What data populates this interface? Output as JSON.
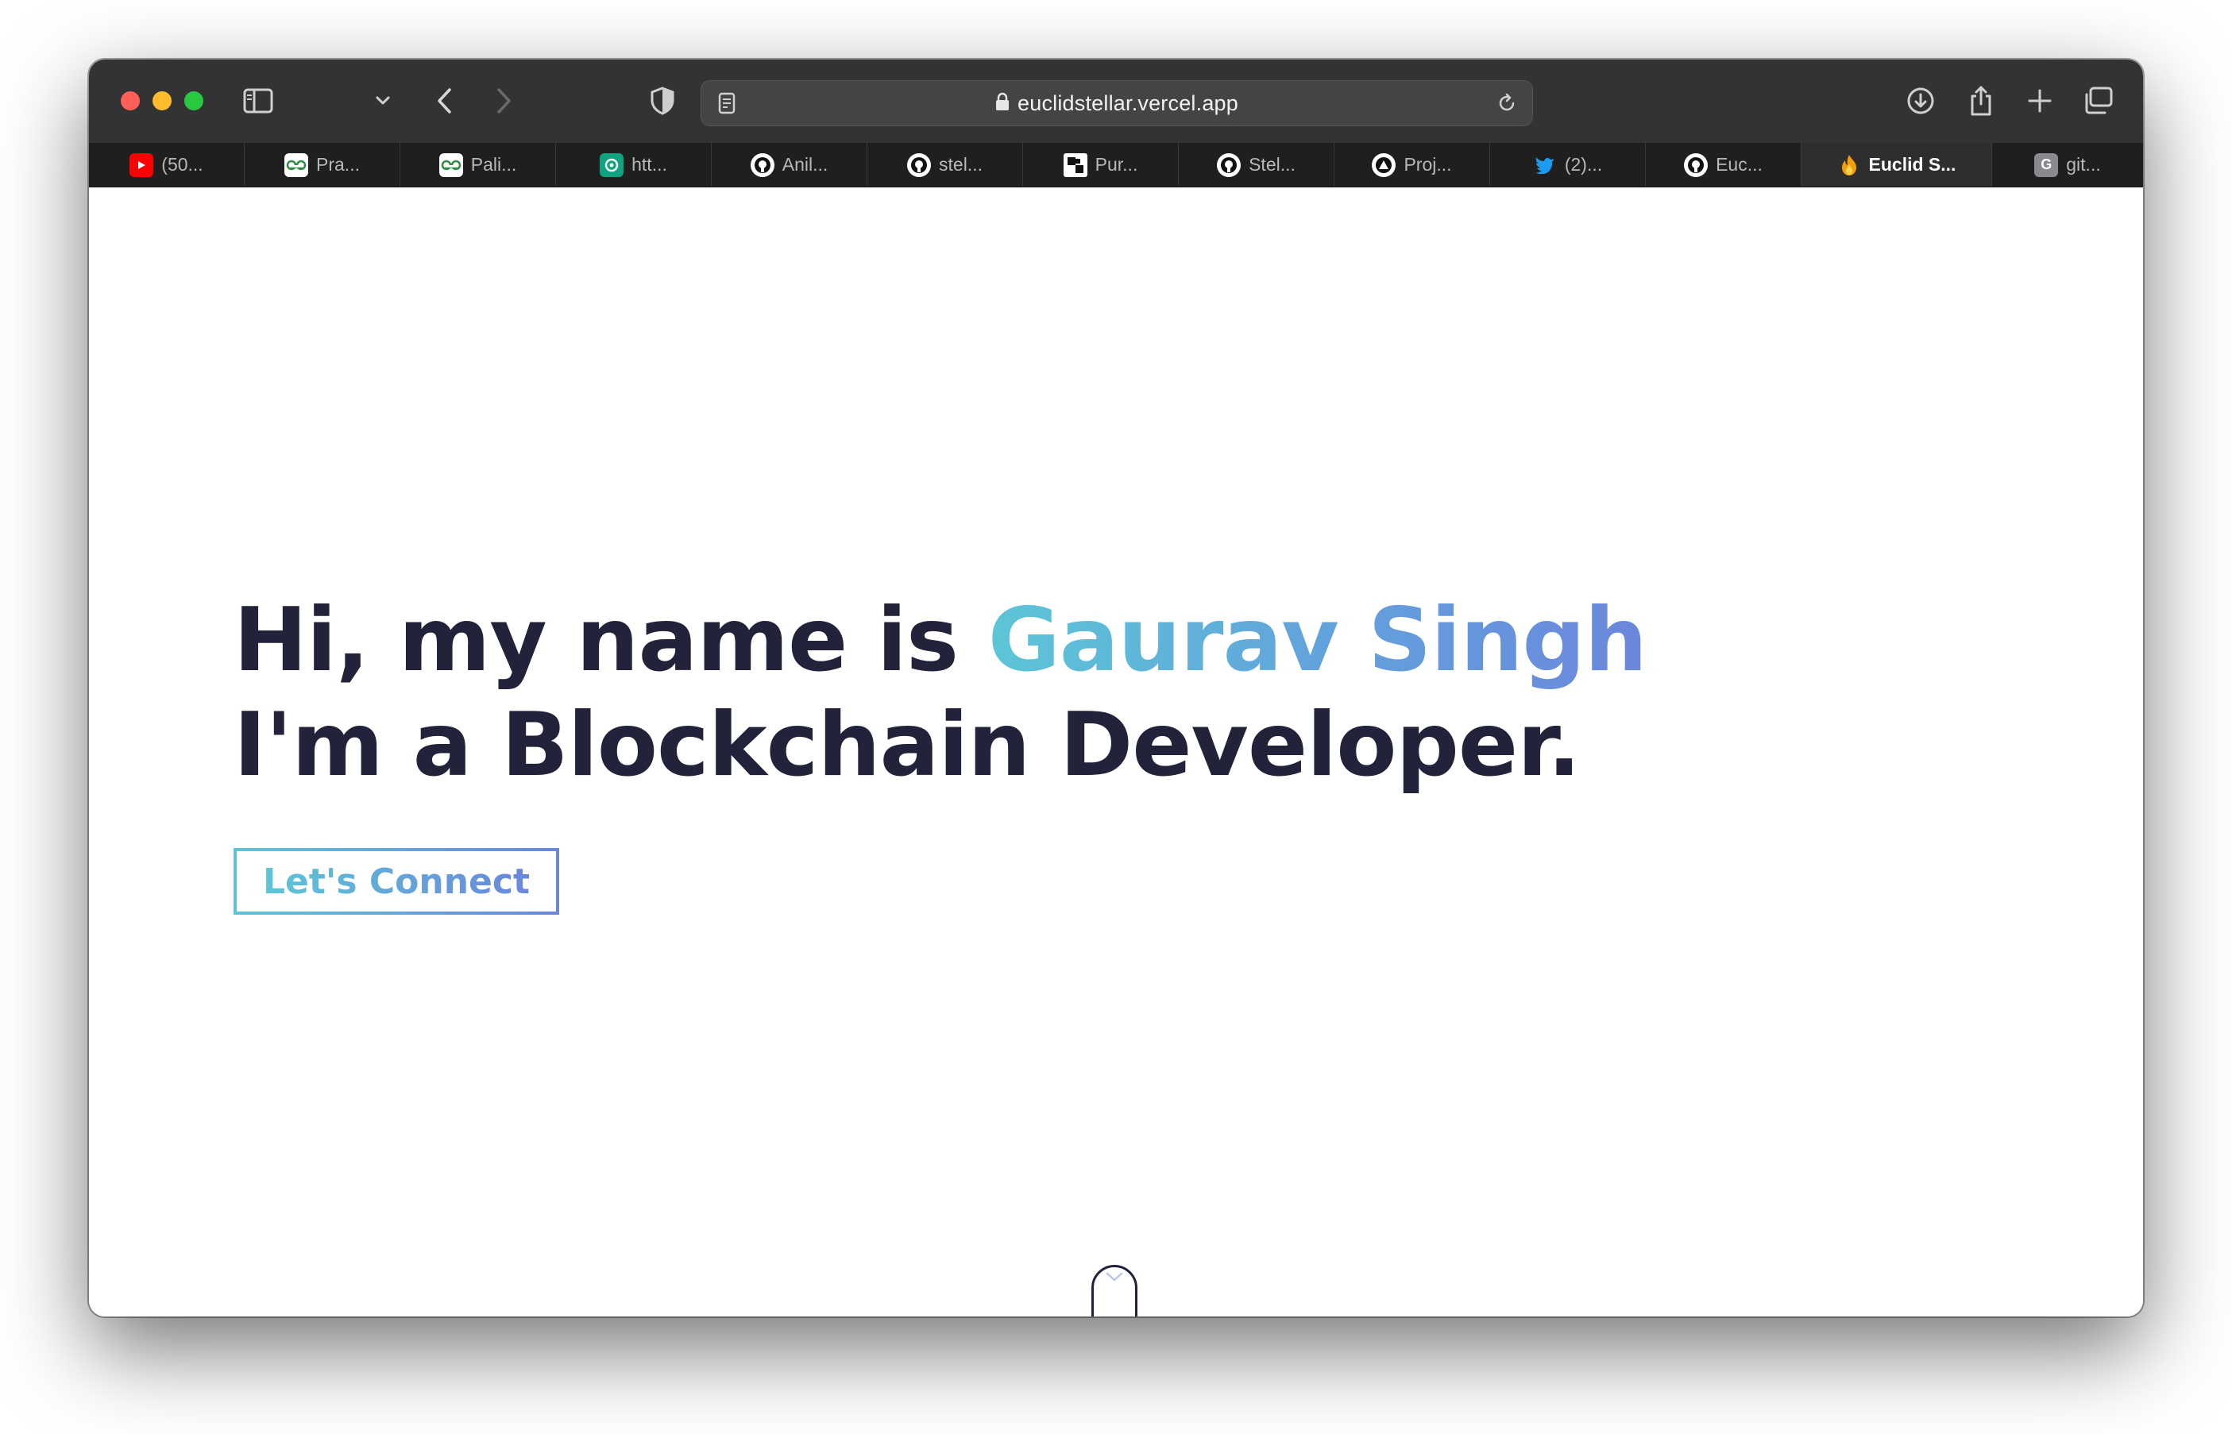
{
  "browser": {
    "url": "euclidstellar.vercel.app",
    "tabs": [
      {
        "label": "(50...",
        "icon": "youtube-icon",
        "color": "#ff0000"
      },
      {
        "label": "Pra...",
        "icon": "geeksforgeeks-icon",
        "color": "#2f8d46"
      },
      {
        "label": "Pali...",
        "icon": "geeksforgeeks-icon",
        "color": "#2f8d46"
      },
      {
        "label": "htt...",
        "icon": "chatgpt-icon",
        "color": "#10a37f"
      },
      {
        "label": "Anil...",
        "icon": "github-icon",
        "color": "#ffffff"
      },
      {
        "label": "stel...",
        "icon": "github-icon",
        "color": "#ffffff"
      },
      {
        "label": "Pur...",
        "icon": "grid-icon",
        "color": "#ffffff"
      },
      {
        "label": "Stel...",
        "icon": "github-icon",
        "color": "#ffffff"
      },
      {
        "label": "Proj...",
        "icon": "vercel-icon",
        "color": "#ffffff"
      },
      {
        "label": "(2)...",
        "icon": "twitter-icon",
        "color": "#1d9bf0"
      },
      {
        "label": "Euc...",
        "icon": "github-icon",
        "color": "#ffffff"
      },
      {
        "label": "Euclid S...",
        "icon": "fire-icon",
        "color": "#f59e0b",
        "active": true
      },
      {
        "label": "git...",
        "icon": "g-icon",
        "color": "#8a8a8e"
      }
    ]
  },
  "hero": {
    "greeting": "Hi, my name is ",
    "name": "Gaurav Singh",
    "role_line": "I'm a Blockchain Developer.",
    "cta_label": "Let's Connect"
  },
  "colors": {
    "text_dark": "#22223b",
    "gradient_start": "#5cc6d6",
    "gradient_end": "#6b86dc"
  }
}
